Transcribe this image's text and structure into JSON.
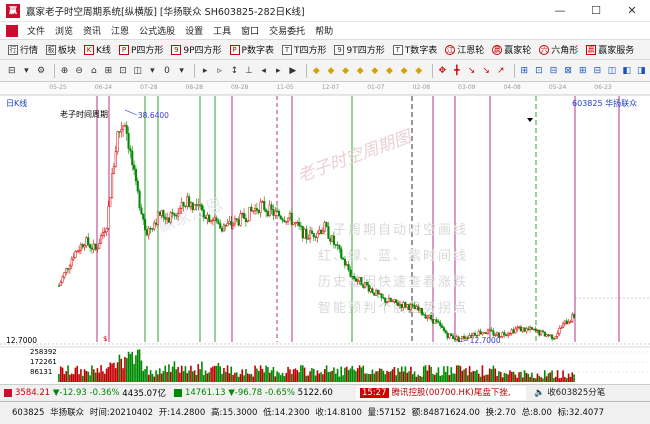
{
  "window": {
    "title": "赢家老子时空周期系统[纵横版]  [华扬联众  SH603825-282日K线]",
    "logo": "赢",
    "buttons": [
      "—",
      "☐",
      "✕"
    ]
  },
  "menu": [
    "文件",
    "浏览",
    "资讯",
    "江恩",
    "公式选股",
    "设置",
    "工具",
    "窗口",
    "交易委托",
    "帮助"
  ],
  "toolbar1": [
    {
      "icon": "行",
      "label": "行情"
    },
    {
      "icon": "板",
      "label": "板块"
    },
    {
      "icon": "K",
      "label": "K线"
    },
    {
      "icon": "P",
      "label": "P四方形"
    },
    {
      "icon": "9",
      "label": "9P四方形"
    },
    {
      "icon": "P",
      "label": "P数字表"
    },
    {
      "icon": "T",
      "label": "T四方形"
    },
    {
      "icon": "9",
      "label": "9T四方形"
    },
    {
      "icon": "T",
      "label": "T数字表"
    },
    {
      "icon": "江",
      "label": "江恩轮"
    },
    {
      "icon": "赢",
      "label": "赢家轮"
    },
    {
      "icon": "六",
      "label": "六角形"
    },
    {
      "icon": "赢",
      "label": "赢家服务"
    }
  ],
  "toolbar2": {
    "zoom_value": "0",
    "tools": [
      "⊟",
      "▾",
      "⚙",
      "⊕",
      "⊖",
      "⌂",
      "⊞",
      "⊡",
      "◫",
      "▾",
      "0",
      "▾",
      "▸",
      "▹",
      "↕",
      "⊥",
      "◂",
      "▸",
      "▶",
      "◆",
      "◆",
      "◆",
      "◆",
      "◆",
      "◆",
      "◆",
      "◆",
      "✥",
      "╋",
      "↘",
      "↘",
      "↗",
      "⊞",
      "⊡",
      "⊟",
      "⊠",
      "⊞",
      "⊟",
      "◫",
      "◧",
      "◨"
    ]
  },
  "chart": {
    "period_label": "日K线",
    "overlay_title": "老子时间周期",
    "stock_label": "603825 华扬联众",
    "high_label": "38.6400",
    "low_label": "12.7000",
    "bottom_price": "12.7000",
    "x_dates": [
      "05-25",
      "06-24",
      "07-28",
      "08-28",
      "09-28",
      "11-05",
      "12-07",
      "01-07",
      "02-08",
      "03-09",
      "04-08",
      "05-24",
      "06-23"
    ],
    "volume_labels": [
      "258392",
      "172261",
      "86131"
    ],
    "watermark_top": "赢家江恩",
    "watermark_mid": "老子时空周期图",
    "promo_lines": [
      "老子周期自动时空画线",
      "红、绿、蓝、紫时间线",
      "历史基因快速查看涨跌",
      "智能预判个股趋势拐点"
    ],
    "colors": {
      "up": "#d90000",
      "down": "#008800",
      "ma": "#3a3acc"
    },
    "price_range": [
      12.7,
      38.64
    ],
    "candle_count": 282
  },
  "ticker": {
    "sh_value": "3584.21",
    "sh_change": "▼-12.93",
    "sh_pct": "-0.36%",
    "sh_amount": "4435.07亿",
    "sz_value": "14761.13",
    "sz_change": "▼-96.78",
    "sz_pct": "-0.65%",
    "sz_amount": "5122.60",
    "news_tag": "15:27",
    "news_text": "腾讯控股(00700.HK)尾盘下挫,",
    "right_text": "收603825分笔"
  },
  "status": {
    "code": "603825",
    "name": "华扬联众",
    "time": "时间:20210402",
    "open": "开:14.2800",
    "high": "高:15.3000",
    "low": "低:14.2300",
    "close": "收:14.8100",
    "volume": "量:57152",
    "amount": "额:84871624.00",
    "turnover": "换:2.70",
    "amplitude": "总:8.00",
    "ratio": "标:32.4077"
  }
}
